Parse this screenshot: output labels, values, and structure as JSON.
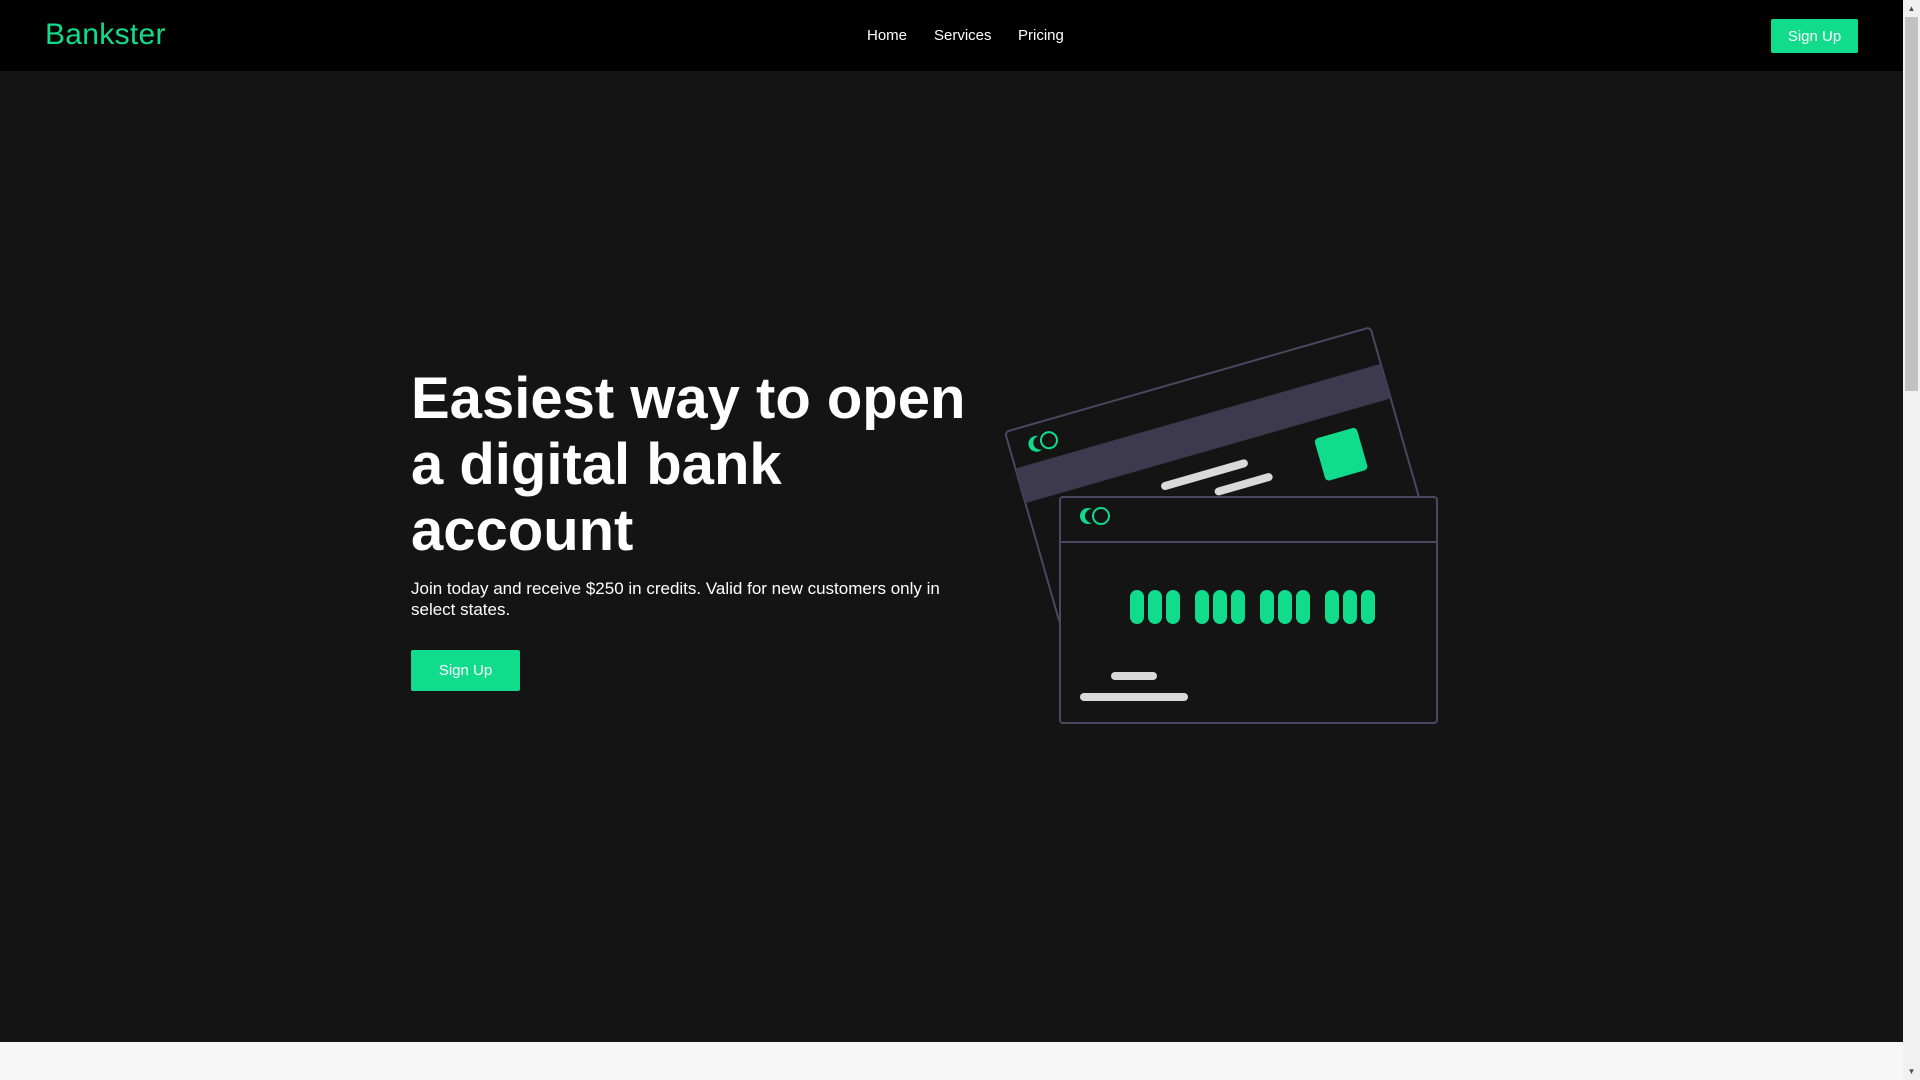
{
  "navbar": {
    "brand": "Bankster",
    "links": [
      "Home",
      "Services",
      "Pricing"
    ],
    "signup_label": "Sign Up"
  },
  "hero": {
    "title": "Easiest way to open a digital bank account",
    "subtitle": "Join today and receive $250 in credits. Valid for new customers only in select states.",
    "signup_label": "Sign Up"
  },
  "scrollbar": {
    "up_arrow": "▲",
    "down_arrow": "▼"
  },
  "colors": {
    "accent": "#10dc8c",
    "navbar_bg": "#000000",
    "page_bg": "#141414",
    "card_stripe": "#3d3a50",
    "card_border": "#4a4760"
  },
  "icons": [
    "card-illustration-icon"
  ]
}
